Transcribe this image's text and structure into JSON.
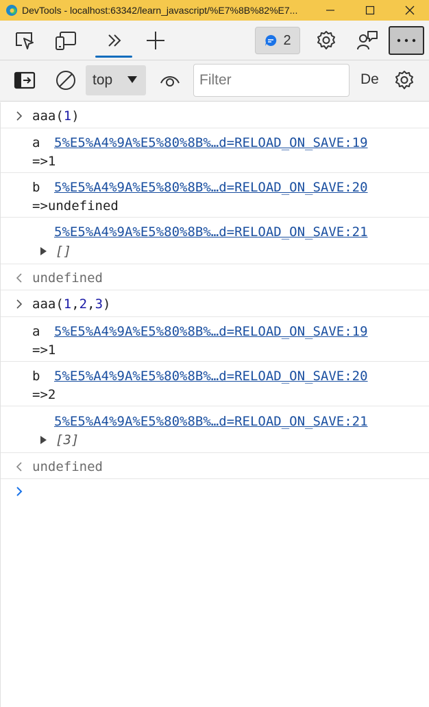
{
  "window": {
    "title": "DevTools - localhost:63342/learn_javascript/%E7%8B%82%E7...",
    "accent": "#f5c84c"
  },
  "toolbar1": {
    "issues_count": "2",
    "icons": [
      "inspect-icon",
      "device-emulation-icon",
      "more-tabs-icon",
      "new-tab-icon",
      "issues-icon",
      "settings-icon",
      "feedback-icon",
      "more-options-icon"
    ]
  },
  "toolbar2": {
    "context": "top",
    "filter_placeholder": "Filter",
    "levels_label": "De"
  },
  "console": {
    "entries": [
      {
        "type": "input",
        "prefix": "aaa(",
        "args": [
          "1"
        ],
        "suffix": ")"
      },
      {
        "type": "log",
        "label": "a",
        "link": "5%E5%A4%9A%E5%80%8B%…d=RELOAD_ON_SAVE:19",
        "value": "=>1"
      },
      {
        "type": "log",
        "label": "b",
        "link": "5%E5%A4%9A%E5%80%8B%…d=RELOAD_ON_SAVE:20",
        "value": "=>undefined"
      },
      {
        "type": "log",
        "label": "",
        "link": "5%E5%A4%9A%E5%80%8B%…d=RELOAD_ON_SAVE:21",
        "value": "[]"
      },
      {
        "type": "result",
        "value": "undefined"
      },
      {
        "type": "input",
        "prefix": "aaa(",
        "args": [
          "1",
          "2",
          "3"
        ],
        "suffix": ")"
      },
      {
        "type": "log",
        "label": "a",
        "link": "5%E5%A4%9A%E5%80%8B%…d=RELOAD_ON_SAVE:19",
        "value": "=>1"
      },
      {
        "type": "log",
        "label": "b",
        "link": "5%E5%A4%9A%E5%80%8B%…d=RELOAD_ON_SAVE:20",
        "value": "=>2"
      },
      {
        "type": "log",
        "label": "",
        "link": "5%E5%A4%9A%E5%80%8B%…d=RELOAD_ON_SAVE:21",
        "value": "[3]"
      },
      {
        "type": "result",
        "value": "undefined"
      }
    ]
  }
}
